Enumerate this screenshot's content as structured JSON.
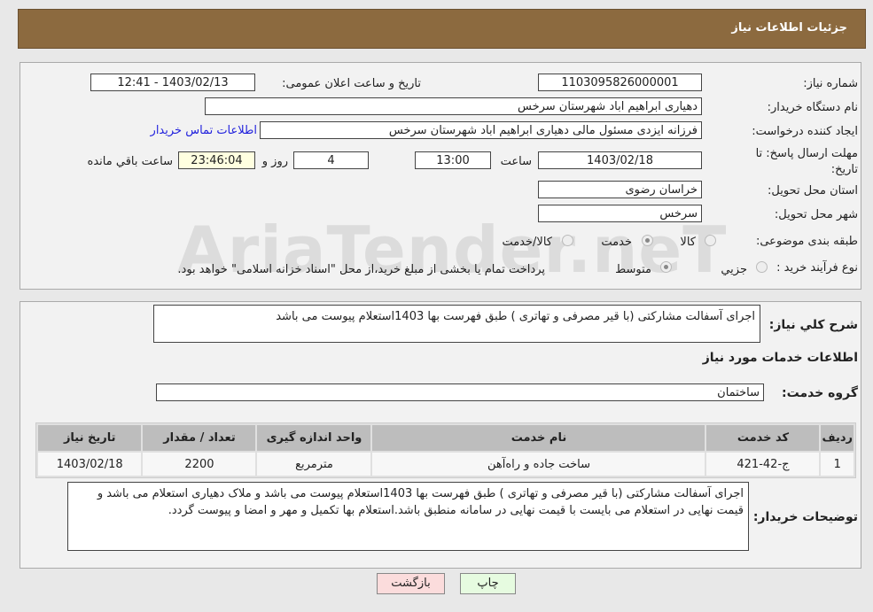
{
  "header": {
    "title": "جزئیات اطلاعات نیاز"
  },
  "watermark": "AriaTender.neT",
  "fields": {
    "need_number_label": "شماره نیاز:",
    "need_number": "1103095826000001",
    "announce_label": "تاریخ و ساعت اعلان عمومی:",
    "announce_value": "1403/02/13 - 12:41",
    "buyer_org_label": "نام دستگاه خریدار:",
    "buyer_org": "دهیاری ابراهیم اباد شهرستان سرخس",
    "creator_label": "ایجاد کننده درخواست:",
    "creator": "فرزانه ایزدی مسئول مالی دهیاری ابراهیم اباد شهرستان سرخس",
    "contact_link": "اطلاعات تماس خریدار",
    "deadline_label": "مهلت ارسال پاسخ: تا تاریخ:",
    "deadline_date": "1403/02/18",
    "time_label": "ساعت",
    "deadline_time": "13:00",
    "days": "4",
    "days_label": "روز و",
    "remaining": "23:46:04",
    "remaining_label": "ساعت باقي مانده",
    "province_label": "استان محل تحویل:",
    "province": "خراسان رضوی",
    "city_label": "شهر محل تحویل:",
    "city": "سرخس",
    "category_label": "طبقه بندی موضوعی:",
    "category_options": [
      "کالا",
      "خدمت",
      "کالا/خدمت"
    ],
    "category_selected": "خدمت",
    "process_label": "نوع فرآیند خرید :",
    "process_options": [
      "جزیي",
      "متوسط"
    ],
    "process_selected": "متوسط",
    "payment_note": "پرداخت تمام یا بخشی از مبلغ خرید،از محل \"اسناد خزانه اسلامی\" خواهد بود.",
    "summary_label": "شرح کلي نیاز:",
    "summary": "اجرای آسفالت مشارکتی (با قیر مصرفی و تهاتری ) طبق فهرست بها 1403استعلام پیوست می باشد",
    "services_heading": "اطلاعات خدمات مورد نیاز",
    "group_label": "گروه خدمت:",
    "group": "ساختمان",
    "buyer_notes_label": "توضیحات خریدار:",
    "buyer_notes": "اجرای آسفالت مشارکتی (با قیر مصرفی و تهاتری ) طبق فهرست بها 1403استعلام پیوست می باشد و ملاک دهیاری استعلام می باشد و قیمت نهایی در استعلام می بایست با قیمت نهایی در سامانه منطبق باشد.استعلام بها تکمیل و مهر و امضا و پیوست گردد."
  },
  "table": {
    "headers": [
      "ردیف",
      "کد خدمت",
      "نام خدمت",
      "واحد اندازه گیری",
      "تعداد / مقدار",
      "تاریخ نیاز"
    ],
    "rows": [
      [
        "1",
        "ج-42-421",
        "ساخت جاده و راه‌آهن",
        "مترمربع",
        "2200",
        "1403/02/18"
      ]
    ]
  },
  "buttons": {
    "print": "چاپ",
    "back": "بازگشت"
  }
}
